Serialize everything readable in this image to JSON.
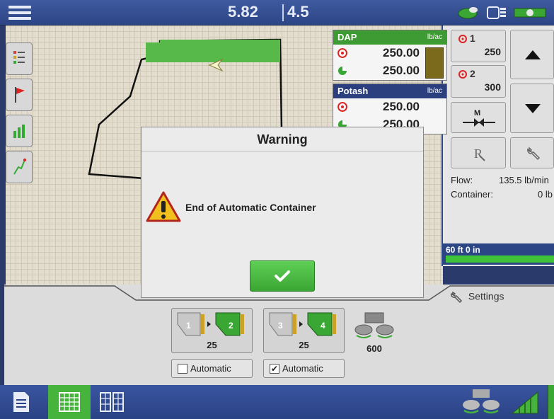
{
  "topbar": {
    "speed": "5.82",
    "rate": "4.5"
  },
  "products": [
    {
      "name": "DAP",
      "unit": "lb/ac",
      "target": "250.00",
      "applied": "250.00",
      "color": "#3e9a32"
    },
    {
      "name": "Potash",
      "unit": "lb/ac",
      "target": "250.00",
      "applied": "250.00",
      "color": "#2b3f7e"
    }
  ],
  "rate_buttons": [
    {
      "label": "1",
      "value": "250"
    },
    {
      "label": "2",
      "value": "300"
    }
  ],
  "info": {
    "flow_label": "Flow:",
    "flow_value": "135.5 lb/min",
    "container_label": "Container:",
    "container_value": "0 lb"
  },
  "implement_width": "60 ft 0 in",
  "settings_label": "Settings",
  "containers": [
    {
      "from": "1",
      "to": "2",
      "count": "25",
      "automatic": false,
      "automatic_label": "Automatic"
    },
    {
      "from": "3",
      "to": "4",
      "count": "25",
      "automatic": true,
      "automatic_label": "Automatic"
    }
  ],
  "spreader_count": "600",
  "dialog": {
    "title": "Warning",
    "message": "End of Automatic Container"
  },
  "colors": {
    "accent_green": "#3dc239",
    "bar_blue": "#2c4585",
    "dap_green": "#3e9a32"
  }
}
